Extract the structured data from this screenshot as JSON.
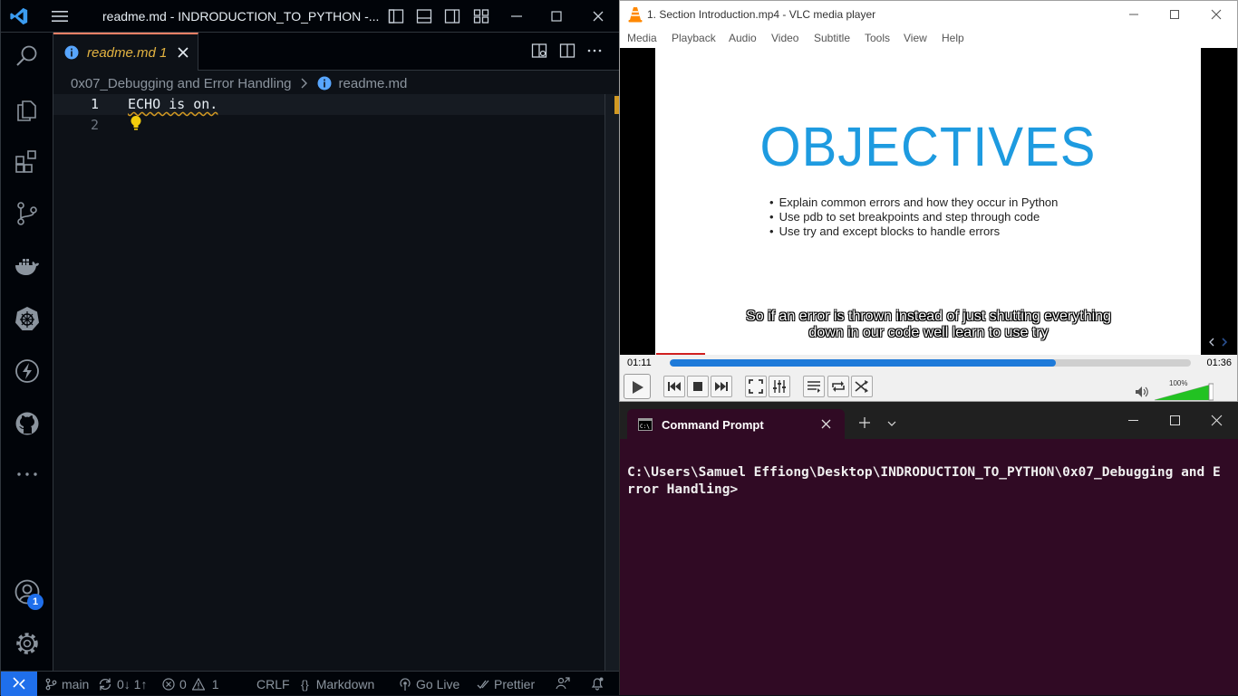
{
  "vscode": {
    "window_title": "readme.md - INDRODUCTION_TO_PYTHON -...",
    "tab": {
      "name": "readme.md",
      "problems": "1"
    },
    "breadcrumb": {
      "folder": "0x07_Debugging and Error Handling",
      "file": "readme.md"
    },
    "editor": {
      "line_numbers": [
        "1",
        "2"
      ],
      "lines": [
        "ECHO is on.",
        ""
      ]
    },
    "account_badge": "1",
    "status": {
      "branch": "main",
      "sync": "0↓ 1↑",
      "errors": "0",
      "warnings": "1",
      "eol": "CRLF",
      "language": "Markdown",
      "golive": "Go Live",
      "prettier": "Prettier"
    },
    "colors": {
      "bg": "#0d1117",
      "accent": "#1f6feb",
      "tab_modified": "#e3b341",
      "warning": "#d29922"
    }
  },
  "vlc": {
    "window_title": "1. Section Introduction.mp4 - VLC media player",
    "menu": [
      "Media",
      "Playback",
      "Audio",
      "Video",
      "Subtitle",
      "Tools",
      "View",
      "Help"
    ],
    "slide": {
      "title": "OBJECTIVES",
      "bullets": [
        "Explain common errors and how they occur in Python",
        "Use pdb to set breakpoints and step through code",
        "Use try and except blocks to handle errors"
      ]
    },
    "subtitle": [
      "So if an error is thrown instead of just shutting everything",
      "down in our code well learn to use try"
    ],
    "time_elapsed": "01:11",
    "time_total": "01:36",
    "progress": 0.74,
    "volume_label": "100%",
    "volume": 1.0,
    "colors": {
      "seek": "#1e7ad9",
      "slide_title": "#1e9be0",
      "volume": "#22c222"
    }
  },
  "cmd": {
    "tab_title": "Command Prompt",
    "prompt": "C:\\Users\\Samuel Effiong\\Desktop\\INDRODUCTION_TO_PYTHON\\0x07_Debugging and Error Handling>",
    "colors": {
      "bg": "#300a24",
      "tabbar": "#202020"
    }
  }
}
